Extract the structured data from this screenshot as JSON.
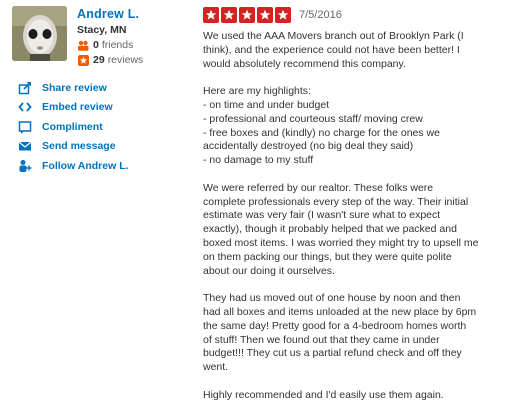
{
  "user": {
    "name": "Andrew L.",
    "location": "Stacy, MN",
    "friends_count": "0",
    "friends_label": "friends",
    "reviews_count": "29",
    "reviews_label": "reviews"
  },
  "actions": [
    {
      "label": "Share review",
      "icon": "share-icon"
    },
    {
      "label": "Embed review",
      "icon": "embed-icon"
    },
    {
      "label": "Compliment",
      "icon": "compliment-icon"
    },
    {
      "label": "Send message",
      "icon": "envelope-icon"
    },
    {
      "label": "Follow Andrew L.",
      "icon": "follow-icon"
    }
  ],
  "review": {
    "rating": 5,
    "date": "7/5/2016",
    "paragraphs": [
      [
        "We used the AAA Movers branch out of Brooklyn Park (I",
        "think), and the experience could not have been better! I",
        "would absolutely recommend this company."
      ],
      [
        "Here are my highlights:",
        "- on time and under budget",
        "- professional and courteous staff/ moving crew",
        "- free boxes and (kindly) no charge for the ones we",
        "accidentally destroyed (no big deal they said)",
        "- no damage to my stuff"
      ],
      [
        "We were referred by our realtor. These folks were",
        "complete professionals every step of the way. Their initial",
        "estimate was very fair (I wasn't sure what to expect",
        "exactly), though it probably helped that we packed and",
        "boxed most items. I was worried they might try to upsell me",
        "on them packing our things, but they were quite polite",
        "about our doing it ourselves."
      ],
      [
        "They had us moved out of one house by noon and then",
        "had all boxes and items unloaded at the new place by 6pm",
        "the same day! Pretty good for a 4-bedroom homes worth",
        "of stuff!  Then we found out that they came in under",
        "budget!!! They cut us a partial refund check and off they",
        "went."
      ],
      [
        "Highly recommended and I'd easily use them again."
      ]
    ]
  },
  "colors": {
    "star_red": "#d32323",
    "link_blue": "#0073bb",
    "friends_orange": "#f15c00"
  }
}
